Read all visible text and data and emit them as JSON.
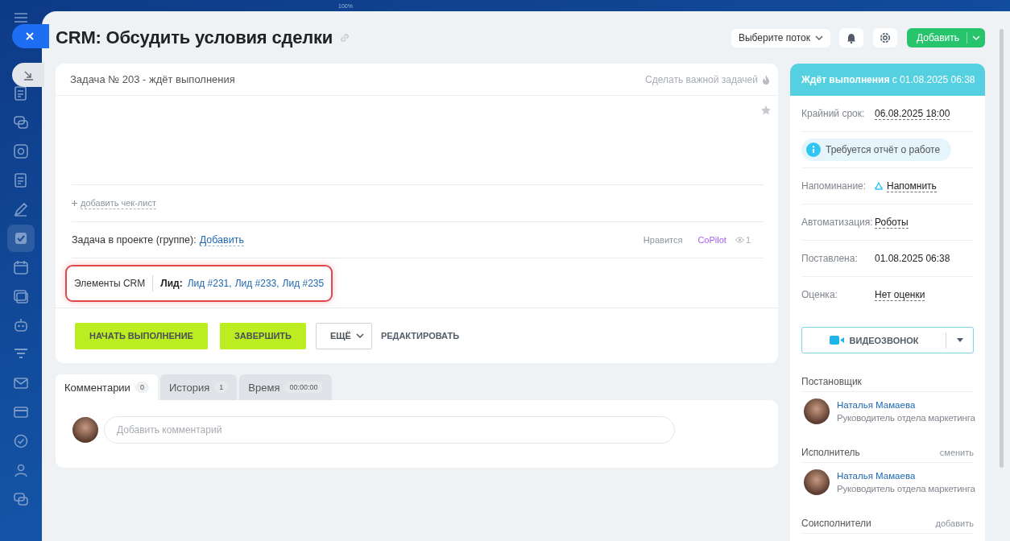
{
  "top_label": "100%",
  "title": "CRM: Обсудить условия сделки",
  "header": {
    "flow_select": "Выберите поток",
    "add_button": "Добавить"
  },
  "task": {
    "heading": "Задача № 203 - ждёт выполнения",
    "important_link": "Сделать важной задачей",
    "checklist_link": "добавить чек-лист",
    "project_label": "Задача в проекте (группе):",
    "project_link": "Добавить",
    "like": "Нравится",
    "copilot": "CoPilot",
    "views": "1",
    "crm_label": "Элементы CRM",
    "crm_type": "Лид:",
    "crm_links": [
      "Лид #231",
      "Лид #233",
      "Лид #235"
    ],
    "crm_separator": ","
  },
  "actions": {
    "start": "НАЧАТЬ ВЫПОЛНЕНИЕ",
    "complete": "ЗАВЕРШИТЬ",
    "more": "ЕЩЁ",
    "edit": "РЕДАКТИРОВАТЬ"
  },
  "tabs": [
    {
      "label": "Комментарии",
      "count": "0",
      "selected": true
    },
    {
      "label": "История",
      "count": "1",
      "selected": false
    },
    {
      "label": "Время",
      "count": "00:00:00",
      "selected": false
    }
  ],
  "comment": {
    "placeholder": "Добавить комментарий"
  },
  "status": "**Ждёт выполнения** с 01.08.2025 06:38",
  "fields": [
    {
      "kind": "link",
      "label": "Крайний срок:",
      "value": "06.08.2025 18:00"
    },
    {
      "kind": "notice",
      "value": "Требуется отчёт о работе"
    },
    {
      "kind": "reminder",
      "label": "Напоминание:",
      "value": "Напомнить"
    },
    {
      "kind": "link",
      "label": "Автоматизация:",
      "value": "Роботы"
    },
    {
      "kind": "text",
      "label": "Поставлена:",
      "value": "01.08.2025 06:38"
    },
    {
      "kind": "link",
      "label": "Оценка:",
      "value": "Нет оценки"
    }
  ],
  "video_call": "ВИДЕОЗВОНОК",
  "roles": [
    {
      "title": "Постановщик",
      "people": [
        {
          "name": "Наталья Мамаева",
          "position": "Руководитель отдела маркетинга"
        }
      ]
    },
    {
      "title": "Исполнитель",
      "action": "сменить",
      "people": [
        {
          "name": "Наталья Мамаева",
          "position": "Руководитель отдела маркетинга"
        }
      ]
    },
    {
      "title": "Соисполнители",
      "action": "добавить"
    }
  ]
}
